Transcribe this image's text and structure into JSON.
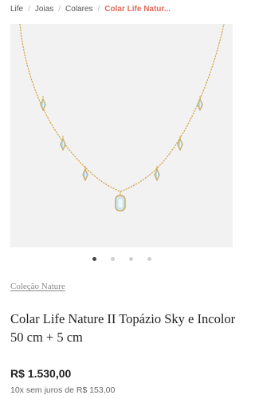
{
  "breadcrumb": {
    "items": [
      "Life",
      "Joias",
      "Colares",
      "Colar Life Natur..."
    ],
    "separator": "/"
  },
  "product_image": {
    "icon": "necklace-image",
    "colors": {
      "chain": "#d4a84a",
      "stone": "#a9cfe3",
      "background": "#f2f2f3"
    }
  },
  "carousel": {
    "count": 4,
    "active_index": 0
  },
  "product": {
    "collection": "Coleção Nature",
    "title": "Colar Life Nature II Topázio Sky e Incolor 50 cm + 5 cm",
    "price": "R$ 1.530,00",
    "installments": "10x sem juros de R$ 153,00"
  },
  "colors": {
    "accent": "#e06b5b"
  }
}
